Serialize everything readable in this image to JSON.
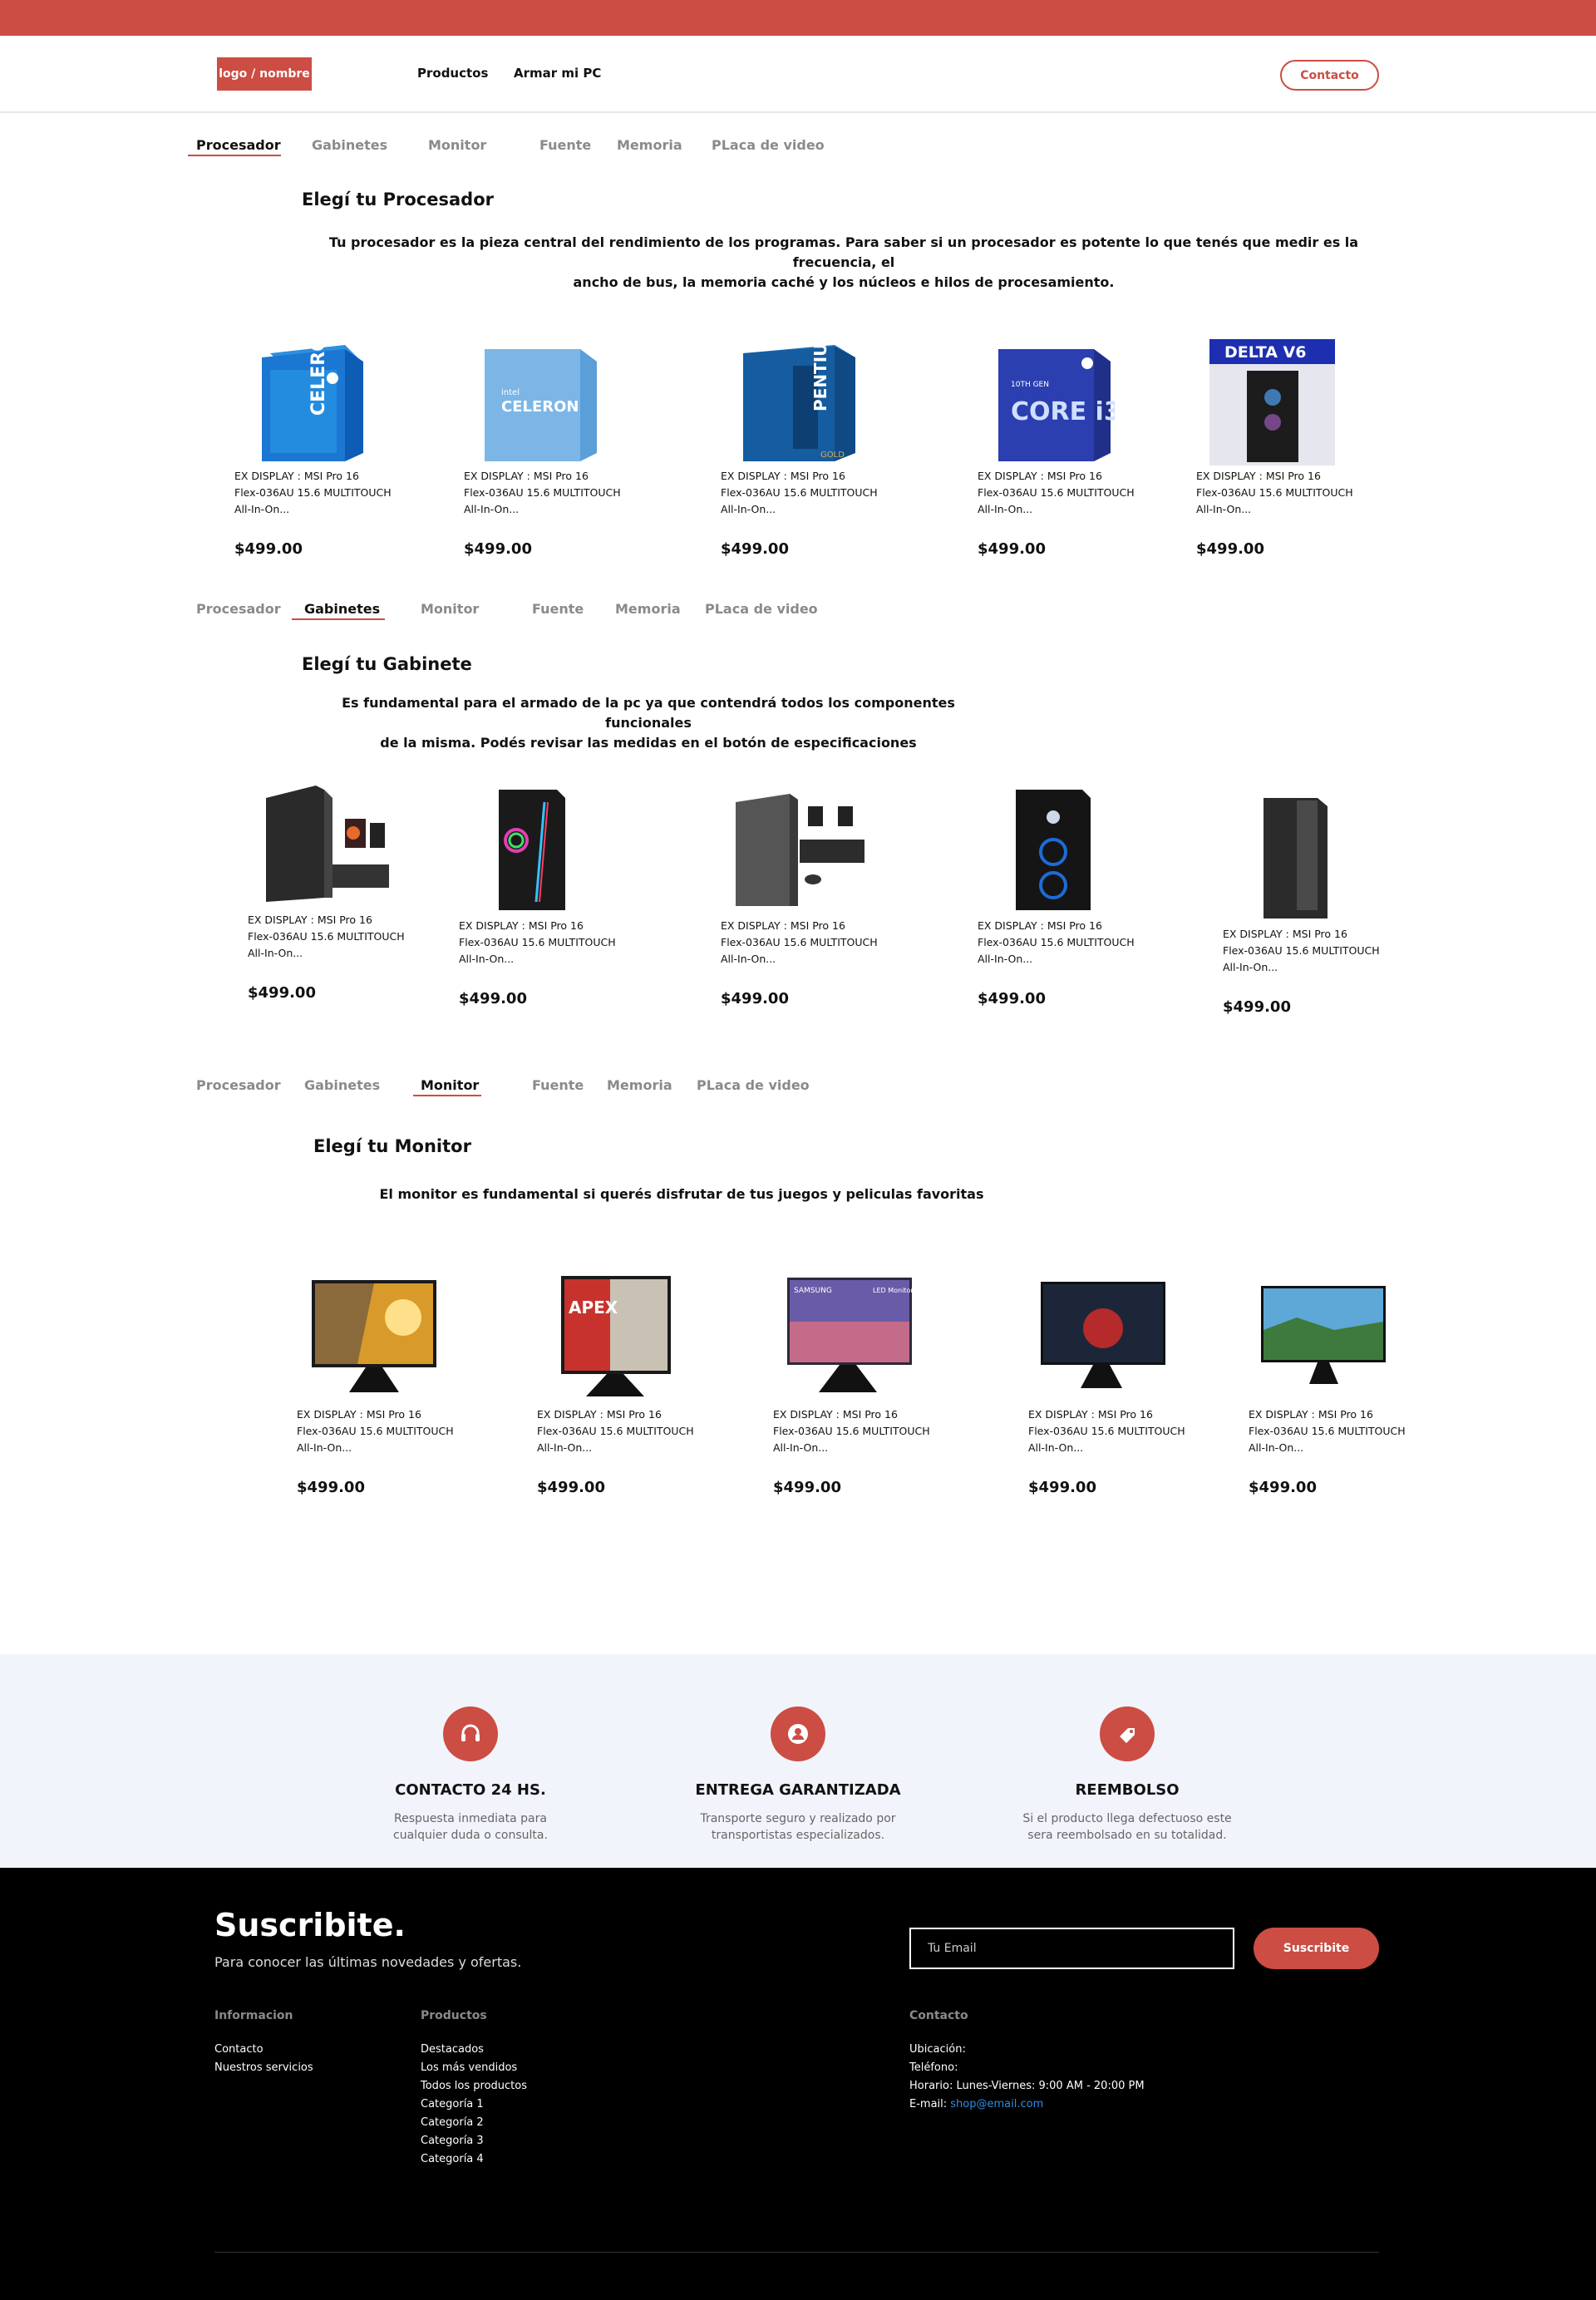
{
  "header": {
    "logo": "logo / nombre",
    "nav": [
      "Productos",
      "Armar mi PC"
    ],
    "contact": "Contacto"
  },
  "tabs": [
    "Procesador",
    "Gabinetes",
    "Monitor",
    "Fuente",
    "Memoria",
    "PLaca de video"
  ],
  "sections": [
    {
      "title": "Elegí tu Procesador",
      "desc_lines": [
        "Tu procesador es la pieza central del rendimiento de los programas. Para saber si un procesador es potente lo que tenés que medir es la frecuencia, el",
        "ancho de bus, la memoria caché y los núcleos e hilos de procesamiento."
      ],
      "active_tab": "Procesador",
      "image_labels": [
        "CELERON",
        "CELERON",
        "PENTIUM",
        "CORE i3",
        "DELTA V6"
      ]
    },
    {
      "title": "Elegí tu Gabinete",
      "desc_lines": [
        "Es fundamental para el armado de la pc ya que contendrá todos los componentes funcionales",
        "de la misma. Podés revisar las medidas en el botón de especificaciones"
      ],
      "active_tab": "Gabinetes"
    },
    {
      "title": "Elegí tu Monitor",
      "desc_lines": [
        "El monitor es fundamental si querés disfrutar de tus juegos y peliculas favoritas"
      ],
      "active_tab": "Monitor",
      "image_labels": [
        "",
        "APEX",
        "SAMSUNG",
        "",
        ""
      ]
    }
  ],
  "product": {
    "name_lines": [
      "EX DISPLAY : MSI Pro 16",
      "Flex-036AU 15.6 MULTITOUCH",
      "All-In-On..."
    ],
    "price": "$499.00"
  },
  "features": [
    {
      "icon": "headset-icon",
      "title": "CONTACTO 24 HS.",
      "lines": [
        "Respuesta inmediata para",
        "cualquier duda o consulta."
      ]
    },
    {
      "icon": "user-icon",
      "title": "ENTREGA GARANTIZADA",
      "lines": [
        "Transporte seguro y realizado por",
        "transportistas especializados."
      ]
    },
    {
      "icon": "tag-icon",
      "title": "REEMBOLSO",
      "lines": [
        "Si el producto llega defectuoso este",
        "sera reembolsado en su totalidad."
      ]
    }
  ],
  "footer": {
    "title": "Suscribite.",
    "subtitle": "Para conocer las últimas novedades y ofertas.",
    "email_placeholder": "Tu Email",
    "subscribe": "Suscribite",
    "informacion": {
      "title": "Informacion",
      "links": [
        "Contacto",
        "Nuestros servicios"
      ]
    },
    "productos": {
      "title": "Productos",
      "links": [
        "Destacados",
        "Los más vendidos",
        "Todos los productos",
        "Categoría 1",
        "Categoría 2",
        "Categoría 3",
        "Categoría 4"
      ]
    },
    "contacto": {
      "title": "Contacto",
      "lines": [
        "Ubicación:",
        "Teléfono:",
        "Horario: Lunes-Viernes: 9:00 AM - 20:00 PM"
      ],
      "email_label": "E-mail: ",
      "email": "shop@email.com"
    }
  },
  "colors": {
    "accent": "#cc4d43",
    "features_bg": "#f1f4fb",
    "footer_bg": "#000000",
    "link": "#2f8de4"
  }
}
